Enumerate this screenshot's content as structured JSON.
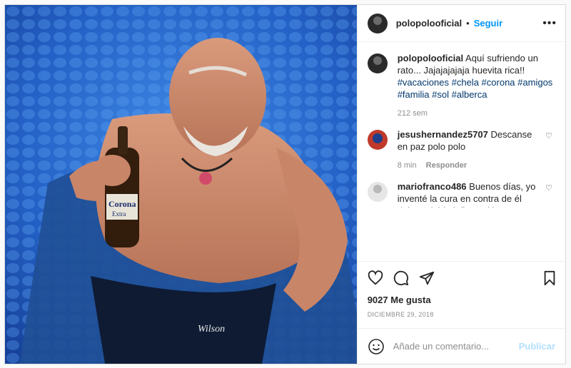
{
  "post": {
    "username": "polopolooficial",
    "follow_label": "Seguir",
    "more_label": "•••",
    "caption": {
      "text": "Aquí sufriendo un rato... Jajajajajaja huevita rica!!",
      "hashtags": [
        "#vacaciones",
        "#chela",
        "#corona",
        "#amigos",
        "#familia",
        "#sol",
        "#alberca"
      ],
      "time": "212 sem"
    },
    "comments": [
      {
        "username": "jesushernandez5707",
        "text": "Descanse en paz polo polo",
        "time": "8 min",
        "reply_label": "Responder"
      },
      {
        "username": "mariofranco486",
        "text": "Buenos días, yo inventé la cura en contra de él dolor y debla inflamación y también sirve para regenerar conecciones en el cerebro, escuche que tiene altz heimmer yo puedo ayudarlo. 5545608573 5585571917 estoy en encontrarlas si pueden"
      }
    ],
    "likes": "9027 Me gusta",
    "date": "DICIEMBRE 29, 2018",
    "comment_placeholder": "Añade un comentario...",
    "publish_label": "Publicar",
    "photo_text": {
      "bottle_brand": "Corona",
      "bottle_sub": "Extra",
      "trunks_brand": "Wilson"
    }
  },
  "colors": {
    "link": "#0095f6",
    "hashtag": "#00376b",
    "muted": "#8e8e8e",
    "pool": "#1d57b8"
  }
}
